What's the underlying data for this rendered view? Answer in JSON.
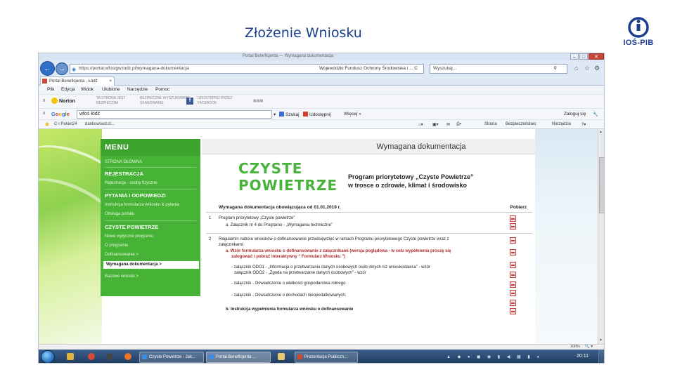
{
  "slide": {
    "title": "Złożenie Wniosku",
    "logo_text": "IOŚ-PIB"
  },
  "browser": {
    "window_title": "Portal Beneficjenta — Wymagana dokumentacja",
    "address": "https://portal.wfosigw.lodz.pl/wymagana-dokumentacja",
    "cert": "Wojewódzki Fundusz Ochrony Środowiska i ... C",
    "search_placeholder": "Wyszukaj...",
    "tab_label": "Portal Beneficjenta - Łódź",
    "menu": [
      "Plik",
      "Edycja",
      "Widok",
      "Ulubione",
      "Narzędzie",
      "Pomoc"
    ],
    "norton": {
      "label": "Norton",
      "item1_line1": "TA STRONA JEST",
      "item1_line2": "BEZPIECZNA",
      "item2_line1": "BEZPIECZNE WYSZUKIWANIE",
      "item2_line2": "SKANOWANIE",
      "item3_line1": "UDOSTĘPNIJ PRZEZ",
      "item3_line2": "FACEBOOK"
    },
    "google": {
      "logo": "Google",
      "query": "wfoś łódź",
      "szukaj": "Szukaj",
      "udostepnij": "Udostępnij",
      "wiecej": "Więcej »",
      "zaloguj": "Zaloguj się"
    },
    "favorites": {
      "item1": "C-i Pakiet24",
      "item2": "dankowood.cl..."
    },
    "commands": {
      "strona": "Strona",
      "bezpieczenstwo": "Bezpieczeństwo",
      "narzedzia": "Narzędzia"
    },
    "zoom": "100%"
  },
  "sidebar": {
    "header": "MENU",
    "strona_glowna": "STRONA GŁÓWNA",
    "rejestracja": "REJESTRACJA",
    "rejestracja_osoby": "Rejestracja - osoby fizyczne",
    "pytania": "PYTANIA I ODPOWIEDZI",
    "pytania_item1": "Instrukcja formularza wniosku & pytania",
    "pytania_item2": "Obsługa portalu",
    "czyste": "CZYSTE POWIETRZE",
    "czyste_item1": "Nowe wytyczne programu",
    "czyste_item2": "O programie",
    "dofinansowanie": "Dofinansowanie >",
    "wymagana": "Wymagana dokumentacja >",
    "bazowe": "Bazowe wnioski >"
  },
  "main": {
    "page_title": "Wymagana dokumentacja",
    "czyste_line1": "CZYSTE",
    "czyste_line2": "POWIETRZE",
    "prog_line1": "Program priorytetowy „Czyste Powietrze”",
    "prog_line2": "w trosce o zdrowie, klimat i środowisko",
    "doc_header": "Wymagana dokumentacja obowiązująca od 01.01.2019 r.",
    "pobierz": "Pobierz",
    "row1_num": "1",
    "row1_title": "Program priorytetowy „Czyste powietrze”",
    "row1_sub": "a. Załącznik nr 4 do Programu - „Wymagania techniczne”",
    "row2_num": "2",
    "row2_title": "Regulamin naboru wniosków o dofinansowanie przedsięwzięć w ramach Programu priorytetowego Czyste powietrze wraz z",
    "row2_title2": "załącznikami:",
    "row2_a1": "a. Wzór formularza wniosku o dofinansowanie z załącznikami (wersja poglądowa - w celu wypełnienia proszę się",
    "row2_a2": "zalogować i pobrać interaktywny \" Formularz Wniosku \")",
    "row2_zal1a": "- załącznik ODO1 - „Informacja o przetwarzaniu danych osobowych osób innych niż wnioskodawca” - wzór",
    "row2_zal1b": "załącznik ODO2 - „Zgoda na przetwarzanie danych osobowych” - wzór",
    "row2_zal2": "- załącznik - Oświadczenie o wielkości gospodarstwa rolnego",
    "row2_zal3": "- załącznik - Oświadczenie o dochodach nieopodatkowanych;",
    "row2_b": "b. Instrukcja wypełnienia formularza wniosku o dofinansowanie"
  },
  "taskbar": {
    "task1": "Czyste Powietrze ‑ Jak...",
    "task2": "Portal Beneficjenta ...",
    "task3": "Prezentacja Publiczn...",
    "clock": "20:11"
  }
}
